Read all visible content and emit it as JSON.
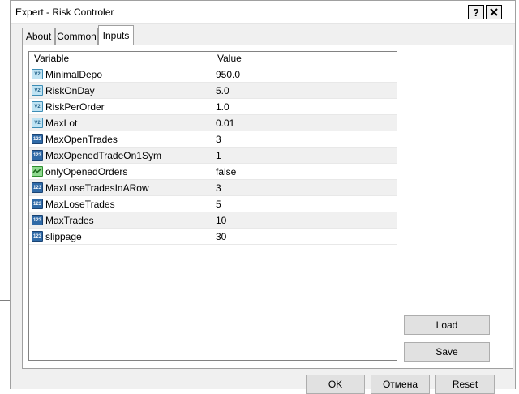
{
  "window": {
    "title": "Expert - Risk Controler",
    "help_label": "?"
  },
  "tabs": [
    {
      "label": "About"
    },
    {
      "label": "Common"
    },
    {
      "label": "Inputs"
    }
  ],
  "table": {
    "headers": {
      "variable": "Variable",
      "value": "Value"
    },
    "rows": [
      {
        "type_icon": "real-number-icon",
        "type_text": "V2",
        "name": "MinimalDepo",
        "value": "950.0"
      },
      {
        "type_icon": "real-number-icon",
        "type_text": "V2",
        "name": "RiskOnDay",
        "value": "5.0"
      },
      {
        "type_icon": "real-number-icon",
        "type_text": "V2",
        "name": "RiskPerOrder",
        "value": "1.0"
      },
      {
        "type_icon": "real-number-icon",
        "type_text": "V2",
        "name": "MaxLot",
        "value": "0.01"
      },
      {
        "type_icon": "integer-icon",
        "type_text": "123",
        "name": "MaxOpenTrades",
        "value": "3"
      },
      {
        "type_icon": "integer-icon",
        "type_text": "123",
        "name": "MaxOpenedTradeOn1Sym",
        "value": "1"
      },
      {
        "type_icon": "boolean-icon",
        "type_text": "",
        "name": "onlyOpenedOrders",
        "value": "false"
      },
      {
        "type_icon": "integer-icon",
        "type_text": "123",
        "name": "MaxLoseTradesInARow",
        "value": "3"
      },
      {
        "type_icon": "integer-icon",
        "type_text": "123",
        "name": "MaxLoseTrades",
        "value": "5"
      },
      {
        "type_icon": "integer-icon",
        "type_text": "123",
        "name": "MaxTrades",
        "value": "10"
      },
      {
        "type_icon": "integer-icon",
        "type_text": "123",
        "name": "slippage",
        "value": "30"
      }
    ]
  },
  "side_buttons": {
    "load": "Load",
    "save": "Save"
  },
  "footer_buttons": {
    "ok": "OK",
    "cancel": "Отмена",
    "reset": "Reset"
  },
  "colors": {
    "real_icon": "#bfe3f3",
    "integer_icon": "#2f6aa7",
    "boolean_icon": "#8fd98f"
  }
}
